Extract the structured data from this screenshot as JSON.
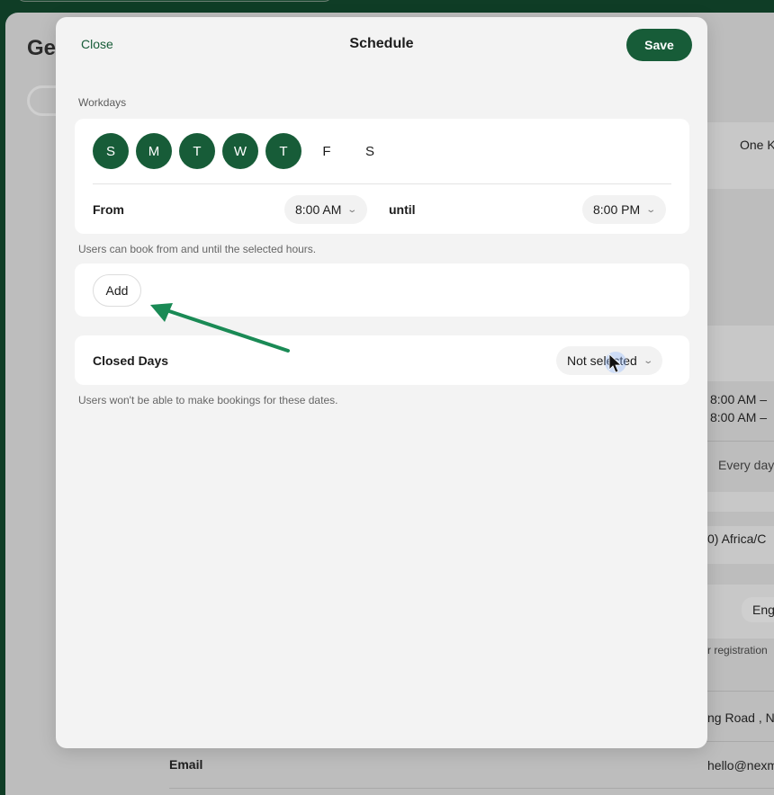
{
  "background": {
    "page_title": "Ge",
    "rows": [
      "One K",
      "8:00 AM –",
      "8:00 AM –",
      "Every day",
      "0) Africa/C",
      "Eng",
      "r registration",
      "ng Road , N",
      "hello@nexm"
    ],
    "email_label": "Email"
  },
  "modal": {
    "close_label": "Close",
    "title": "Schedule",
    "save_label": "Save",
    "workdays_label": "Workdays",
    "days": [
      {
        "label": "S",
        "selected": true
      },
      {
        "label": "M",
        "selected": true
      },
      {
        "label": "T",
        "selected": true
      },
      {
        "label": "W",
        "selected": true
      },
      {
        "label": "T",
        "selected": true
      },
      {
        "label": "F",
        "selected": false
      },
      {
        "label": "S",
        "selected": false
      }
    ],
    "from_label": "From",
    "from_value": "8:00 AM",
    "until_label": "until",
    "until_value": "8:00 PM",
    "hours_helper": "Users can book from and until the selected hours.",
    "add_label": "Add",
    "closed_days_label": "Closed Days",
    "closed_days_value": "Not selected",
    "closed_helper": "Users won't be able to make bookings for these dates."
  },
  "colors": {
    "accent": "#175c38",
    "annotation_arrow": "#1a8a55"
  },
  "icons": {
    "chevron": "chevron-down-icon",
    "cursor": "mouse-pointer-icon"
  }
}
